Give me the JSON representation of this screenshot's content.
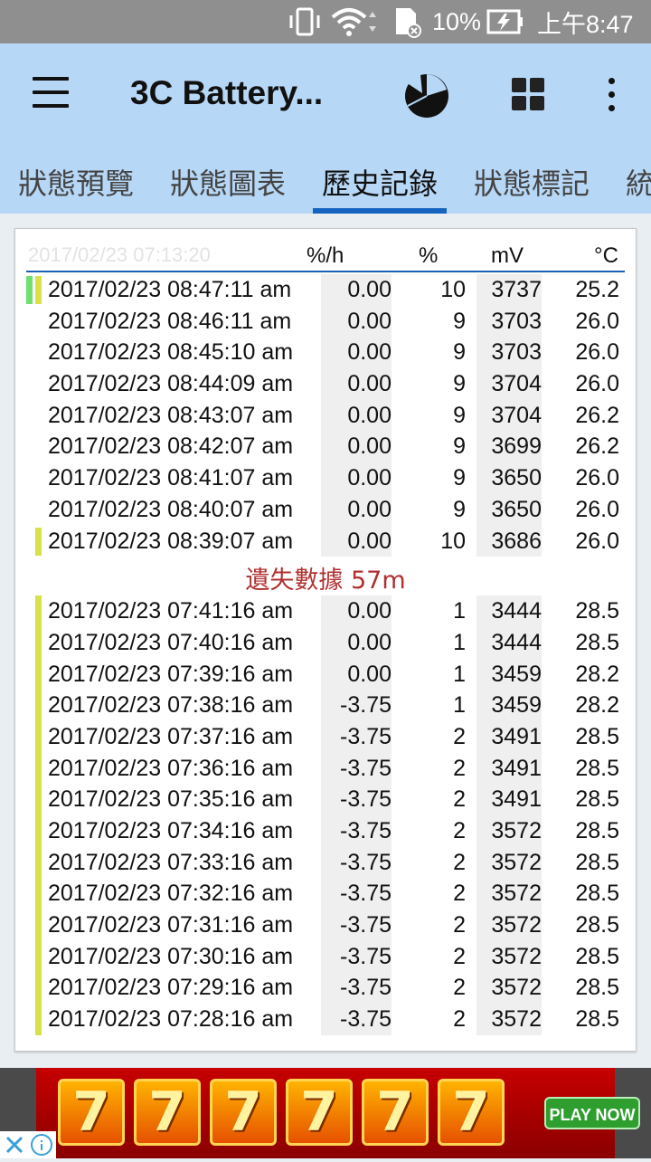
{
  "status_bar": {
    "battery_text": "10%",
    "time": "上午8:47"
  },
  "app_bar": {
    "title": "3C Battery...",
    "icons": [
      "menu-icon",
      "pie-chart-icon",
      "grid-icon",
      "more-vert-icon"
    ]
  },
  "tabs": [
    {
      "label": "狀態預覽",
      "active": false
    },
    {
      "label": "狀態圖表",
      "active": false
    },
    {
      "label": "歷史記錄",
      "active": true
    },
    {
      "label": "狀態標記",
      "active": false
    },
    {
      "label": "統",
      "active": false
    }
  ],
  "table": {
    "ghost_header": "2017/02/23 07:13:20",
    "columns": [
      "%/h",
      "%",
      "mV",
      "°C"
    ],
    "rows_before_gap": [
      {
        "datetime": "2017/02/23  08:47:11 am",
        "rate": "0.00",
        "pct": "10",
        "mv": "3737",
        "temp": "25.2",
        "marker": "green-yellow"
      },
      {
        "datetime": "2017/02/23  08:46:11 am",
        "rate": "0.00",
        "pct": "9",
        "mv": "3703",
        "temp": "26.0",
        "marker": "none"
      },
      {
        "datetime": "2017/02/23  08:45:10 am",
        "rate": "0.00",
        "pct": "9",
        "mv": "3703",
        "temp": "26.0",
        "marker": "none"
      },
      {
        "datetime": "2017/02/23  08:44:09 am",
        "rate": "0.00",
        "pct": "9",
        "mv": "3704",
        "temp": "26.0",
        "marker": "none"
      },
      {
        "datetime": "2017/02/23  08:43:07 am",
        "rate": "0.00",
        "pct": "9",
        "mv": "3704",
        "temp": "26.2",
        "marker": "none"
      },
      {
        "datetime": "2017/02/23  08:42:07 am",
        "rate": "0.00",
        "pct": "9",
        "mv": "3699",
        "temp": "26.2",
        "marker": "none"
      },
      {
        "datetime": "2017/02/23  08:41:07 am",
        "rate": "0.00",
        "pct": "9",
        "mv": "3650",
        "temp": "26.0",
        "marker": "none"
      },
      {
        "datetime": "2017/02/23  08:40:07 am",
        "rate": "0.00",
        "pct": "9",
        "mv": "3650",
        "temp": "26.0",
        "marker": "none"
      },
      {
        "datetime": "2017/02/23  08:39:07 am",
        "rate": "0.00",
        "pct": "10",
        "mv": "3686",
        "temp": "26.0",
        "marker": "yellow"
      }
    ],
    "gap_label": "遺失數據 57m",
    "rows_after_gap": [
      {
        "datetime": "2017/02/23  07:41:16 am",
        "rate": "0.00",
        "pct": "1",
        "mv": "3444",
        "temp": "28.5"
      },
      {
        "datetime": "2017/02/23  07:40:16 am",
        "rate": "0.00",
        "pct": "1",
        "mv": "3444",
        "temp": "28.5"
      },
      {
        "datetime": "2017/02/23  07:39:16 am",
        "rate": "0.00",
        "pct": "1",
        "mv": "3459",
        "temp": "28.2"
      },
      {
        "datetime": "2017/02/23  07:38:16 am",
        "rate": "-3.75",
        "pct": "1",
        "mv": "3459",
        "temp": "28.2"
      },
      {
        "datetime": "2017/02/23  07:37:16 am",
        "rate": "-3.75",
        "pct": "2",
        "mv": "3491",
        "temp": "28.5"
      },
      {
        "datetime": "2017/02/23  07:36:16 am",
        "rate": "-3.75",
        "pct": "2",
        "mv": "3491",
        "temp": "28.5"
      },
      {
        "datetime": "2017/02/23  07:35:16 am",
        "rate": "-3.75",
        "pct": "2",
        "mv": "3491",
        "temp": "28.5"
      },
      {
        "datetime": "2017/02/23  07:34:16 am",
        "rate": "-3.75",
        "pct": "2",
        "mv": "3572",
        "temp": "28.5"
      },
      {
        "datetime": "2017/02/23  07:33:16 am",
        "rate": "-3.75",
        "pct": "2",
        "mv": "3572",
        "temp": "28.5"
      },
      {
        "datetime": "2017/02/23  07:32:16 am",
        "rate": "-3.75",
        "pct": "2",
        "mv": "3572",
        "temp": "28.5"
      },
      {
        "datetime": "2017/02/23  07:31:16 am",
        "rate": "-3.75",
        "pct": "2",
        "mv": "3572",
        "temp": "28.5"
      },
      {
        "datetime": "2017/02/23  07:30:16 am",
        "rate": "-3.75",
        "pct": "2",
        "mv": "3572",
        "temp": "28.5"
      },
      {
        "datetime": "2017/02/23  07:29:16 am",
        "rate": "-3.75",
        "pct": "2",
        "mv": "3572",
        "temp": "28.5"
      },
      {
        "datetime": "2017/02/23  07:28:16 am",
        "rate": "-3.75",
        "pct": "2",
        "mv": "3572",
        "temp": "28.5"
      }
    ],
    "marker_colors": {
      "green": "#6ee06e",
      "yellow": "#d8e04a"
    }
  },
  "ad": {
    "slot_symbol": "7",
    "slot_count": 6,
    "cta": "PLAY NOW",
    "close_symbol": "✕"
  }
}
